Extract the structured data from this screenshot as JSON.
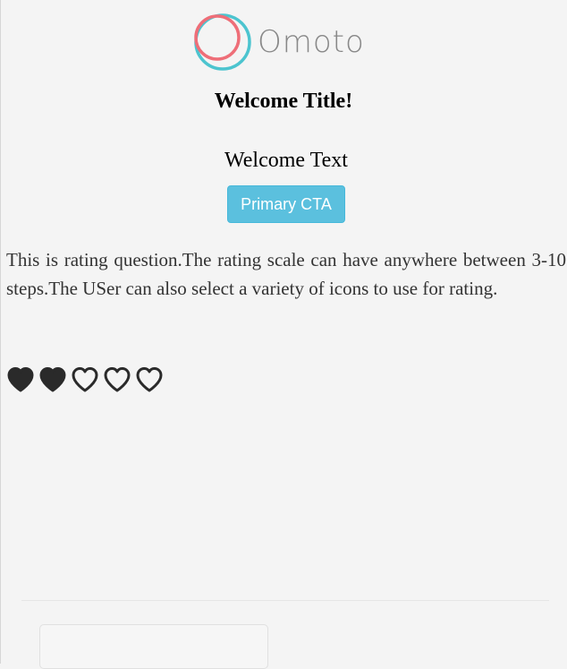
{
  "brand": {
    "name": "Omoto",
    "ring_outer_color": "#4cc4cf",
    "ring_inner_color": "#ee6e78"
  },
  "welcome": {
    "title": "Welcome Title!",
    "text": "Welcome Text"
  },
  "cta": {
    "label": "Primary CTA",
    "color": "#5bc0de"
  },
  "question": {
    "text": "This is rating question.The rating scale can have anywhere between 3-10 steps.The USer can also select a variety of icons to use for rating."
  },
  "rating": {
    "icon": "heart-icon",
    "scale": 5,
    "value": 2,
    "color": "#2a2a2a"
  },
  "footer": {
    "input_value": ""
  }
}
